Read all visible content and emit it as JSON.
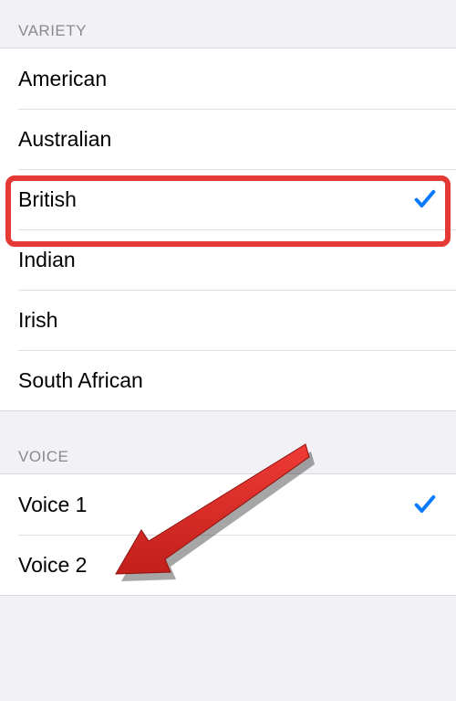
{
  "sections": {
    "variety": {
      "header": "Variety",
      "items": [
        {
          "label": "American",
          "selected": false
        },
        {
          "label": "Australian",
          "selected": false
        },
        {
          "label": "British",
          "selected": true
        },
        {
          "label": "Indian",
          "selected": false
        },
        {
          "label": "Irish",
          "selected": false
        },
        {
          "label": "South African",
          "selected": false
        }
      ]
    },
    "voice": {
      "header": "Voice",
      "items": [
        {
          "label": "Voice 1",
          "selected": true
        },
        {
          "label": "Voice 2",
          "selected": false
        }
      ]
    }
  },
  "colors": {
    "accent": "#0a7aff",
    "highlight": "#e53935"
  }
}
